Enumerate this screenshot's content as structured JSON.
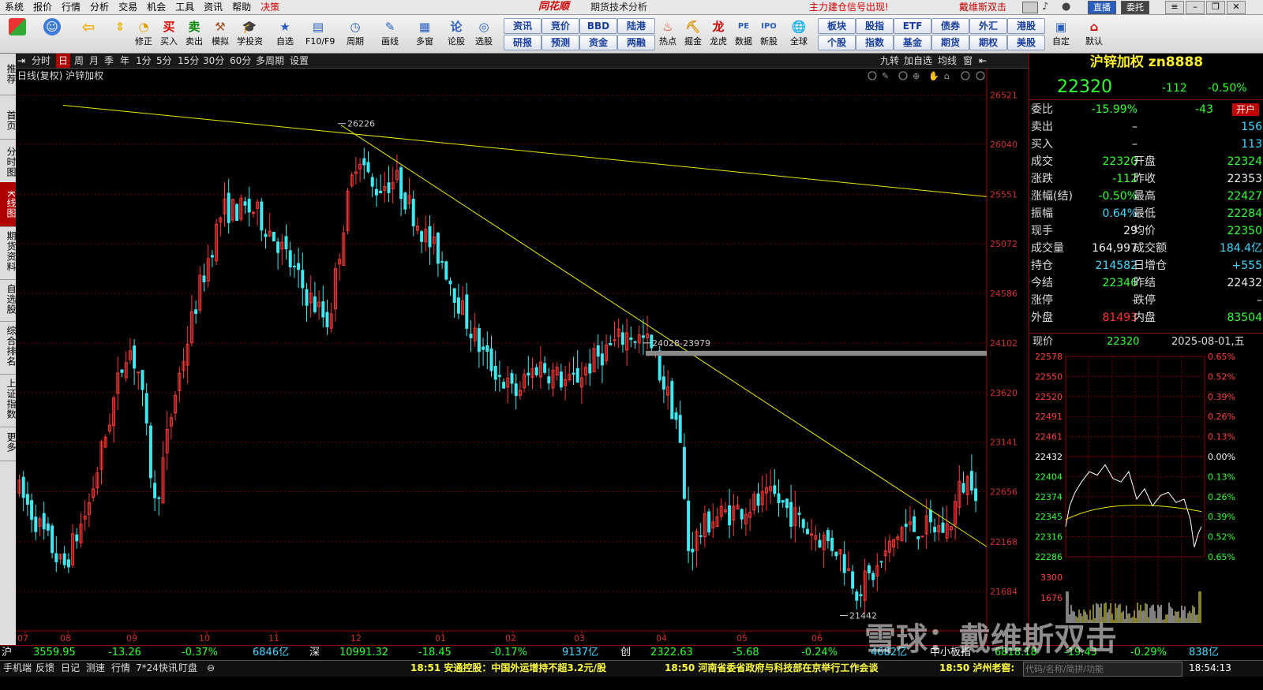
{
  "menu": [
    "系统",
    "报价",
    "行情",
    "分析",
    "交易",
    "机会",
    "工具",
    "资讯",
    "帮助",
    "决策"
  ],
  "brand": "同花顺",
  "brand_sub": "期货技术分析",
  "notice": "主力建仓信号出现!",
  "notice2": "戴维斯双击",
  "top_buttons": [
    "直播",
    "委托"
  ],
  "toolbar": [
    {
      "label": "",
      "icon": "app-grid-icon"
    },
    {
      "label": "",
      "icon": "robot-icon"
    },
    {
      "label": "",
      "icon": "back-arrow-icon"
    },
    {
      "label": "",
      "icon": "up-down-arrow-icon"
    },
    {
      "label": "修正",
      "icon": "correct-icon"
    },
    {
      "label": "买入",
      "icon": "buy-icon"
    },
    {
      "label": "卖出",
      "icon": "sell-icon"
    },
    {
      "label": "模拟",
      "icon": "hammer-icon"
    },
    {
      "label": "学投资",
      "icon": "grad-cap-icon"
    },
    {
      "label": "自选",
      "icon": "star-icon"
    },
    {
      "label": "F10/F9",
      "icon": "f10-icon"
    },
    {
      "label": "周期",
      "icon": "clock-icon"
    },
    {
      "label": "画线",
      "icon": "pen-icon"
    },
    {
      "label": "多窗",
      "icon": "multi-window-icon"
    },
    {
      "label": "论股",
      "icon": "discuss-icon"
    },
    {
      "label": "选股",
      "icon": "select-stock-icon"
    }
  ],
  "toolbar_boxes": [
    [
      "资讯",
      "研报"
    ],
    [
      "竞价",
      "预测"
    ],
    [
      "BBD",
      "资金"
    ],
    [
      "陆港",
      "两融"
    ]
  ],
  "toolbar2": [
    {
      "label": "热点",
      "icon": "hot-icon"
    },
    {
      "label": "掘金",
      "icon": "dig-gold-icon"
    },
    {
      "label": "龙虎",
      "icon": "dragon-tiger-icon"
    },
    {
      "label": "数据",
      "icon": "pe-data-icon"
    },
    {
      "label": "新股",
      "icon": "ipo-icon"
    },
    {
      "label": "全球",
      "icon": "globe-icon"
    }
  ],
  "toolbar_boxes2": [
    [
      "板块",
      "个股"
    ],
    [
      "股指",
      "指数"
    ],
    [
      "ETF",
      "基金"
    ],
    [
      "债券",
      "期货"
    ],
    [
      "外汇",
      "期权"
    ],
    [
      "港股",
      "美股"
    ]
  ],
  "toolbar3": [
    {
      "label": "自定",
      "icon": "custom-icon"
    },
    {
      "label": "默认",
      "icon": "home-icon"
    }
  ],
  "left_tabs": [
    {
      "label": "推荐",
      "active": false
    },
    {
      "label": "首页",
      "active": false
    },
    {
      "label": "分时图",
      "active": false
    },
    {
      "label": "K线图",
      "active": true
    },
    {
      "label": "期货资料",
      "active": false
    },
    {
      "label": "自选股",
      "active": false
    },
    {
      "label": "综合排名",
      "active": false
    },
    {
      "label": "上证指数",
      "active": false
    },
    {
      "label": "更多",
      "active": false
    }
  ],
  "period_bar": {
    "items": [
      "分时",
      "日",
      "周",
      "月",
      "季",
      "年",
      "1分",
      "5分",
      "15分",
      "30分",
      "60分",
      "多周期",
      "设置"
    ],
    "active": "日",
    "right_items": [
      "九转",
      "加自选",
      "均线",
      "窗"
    ]
  },
  "chart_header": "日线(复权) 沪锌加权",
  "chart_data": {
    "type": "candlestick",
    "title": "日线(复权) 沪锌加权",
    "ylim": [
      21400,
      26700
    ],
    "yticks": [
      26521,
      26040,
      25551,
      25072,
      24586,
      24102,
      23620,
      23141,
      22656,
      22168,
      21684
    ],
    "xticks": [
      "07",
      "08",
      "09",
      "10",
      "11",
      "12",
      "01",
      "02",
      "03",
      "04",
      "05",
      "06"
    ],
    "annotations": [
      "26226",
      "24028-23979",
      "21442"
    ],
    "key_points": [
      {
        "label": "high",
        "value": 26226
      },
      {
        "label": "gap",
        "range": [
          23979,
          24028
        ]
      },
      {
        "label": "low",
        "value": 21442
      },
      {
        "label": "last",
        "value": 22320
      }
    ]
  },
  "right_panel": {
    "title": "沪锌加权  zn8888",
    "price": "22320",
    "change": "-112",
    "change_pct": "-0.50%",
    "rows": [
      {
        "l": "委比",
        "v1": "-15.99%",
        "l2": "",
        "v2": "-43",
        "c1": "dn",
        "c2": "dn",
        "extra": "开户"
      },
      {
        "l": "卖出",
        "v1": "–",
        "l2": "",
        "v2": "156",
        "c1": "wh",
        "c2": "cy"
      },
      {
        "l": "买入",
        "v1": "–",
        "l2": "",
        "v2": "113",
        "c1": "wh",
        "c2": "cy"
      },
      {
        "l": "成交",
        "v1": "22320",
        "l2": "开盘",
        "v2": "22324",
        "c1": "dn",
        "c2": "dn"
      },
      {
        "l": "涨跌",
        "v1": "-112",
        "l2": "昨收",
        "v2": "22353",
        "c1": "dn",
        "c2": "wh"
      },
      {
        "l": "涨幅(结)",
        "v1": "-0.50%",
        "l2": "最高",
        "v2": "22427",
        "c1": "dn",
        "c2": "dn"
      },
      {
        "l": "振幅",
        "v1": "0.64%",
        "l2": "最低",
        "v2": "22284",
        "c1": "cy",
        "c2": "dn"
      },
      {
        "l": "现手",
        "v1": "29",
        "l2": "均价",
        "v2": "22350",
        "c1": "wh",
        "c2": "dn"
      },
      {
        "l": "成交量",
        "v1": "164,997",
        "l2": "成交额",
        "v2": "184.4亿",
        "c1": "wh",
        "c2": "cy"
      },
      {
        "l": "持仓",
        "v1": "214582",
        "l2": "日增仓",
        "v2": "+555",
        "c1": "cy",
        "c2": "cy"
      },
      {
        "l": "今结",
        "v1": "22346",
        "l2": "昨结",
        "v2": "22432",
        "c1": "dn",
        "c2": "wh"
      },
      {
        "l": "涨停",
        "v1": "–",
        "l2": "跌停",
        "v2": "–",
        "c1": "wh",
        "c2": "wh"
      },
      {
        "l": "外盘",
        "v1": "81493",
        "l2": "内盘",
        "v2": "83504",
        "c1": "up",
        "c2": "dn"
      }
    ],
    "mini_header": {
      "label": "现价",
      "price": "22320",
      "date": "2025-08-01,五"
    },
    "mini_left": [
      "22578",
      "22550",
      "22520",
      "22491",
      "22461",
      "22432",
      "22404",
      "22374",
      "22345",
      "22316",
      "22286"
    ],
    "mini_right": [
      "0.65%",
      "0.52%",
      "0.39%",
      "0.26%",
      "0.13%",
      "0.00%",
      "0.13%",
      "0.26%",
      "0.39%",
      "0.52%",
      "0.65%"
    ],
    "mini_vol": [
      "3300",
      "1676"
    ]
  },
  "index_bar": [
    {
      "t": "沪",
      "c": "wh"
    },
    {
      "t": "3559.95",
      "c": "dn"
    },
    {
      "t": "-13.26",
      "c": "dn"
    },
    {
      "t": "-0.37%",
      "c": "dn"
    },
    {
      "t": "6846亿",
      "c": "cy"
    },
    {
      "t": "深",
      "c": "wh"
    },
    {
      "t": "10991.32",
      "c": "dn"
    },
    {
      "t": "-18.45",
      "c": "dn"
    },
    {
      "t": "-0.17%",
      "c": "dn"
    },
    {
      "t": "9137亿",
      "c": "cy"
    },
    {
      "t": "创",
      "c": "wh"
    },
    {
      "t": "2322.63",
      "c": "dn"
    },
    {
      "t": "-5.68",
      "c": "dn"
    },
    {
      "t": "-0.24%",
      "c": "dn"
    },
    {
      "t": "4682亿",
      "c": "cy"
    },
    {
      "t": "中小板指",
      "c": "wh"
    },
    {
      "t": "6818.18",
      "c": "dn"
    },
    {
      "t": "-19.43",
      "c": "dn"
    },
    {
      "t": "-0.29%",
      "c": "dn"
    },
    {
      "t": "838亿",
      "c": "cy"
    }
  ],
  "status_bar": {
    "tabs": [
      "手机端",
      "反馈",
      "日记",
      "测速",
      "行情",
      "7*24快讯",
      "盯盘"
    ],
    "news": [
      "18:51 安通控股：中国外运增持不超3.2元/股",
      "18:50 河南省委省政府与科技部在京举行工作会谈",
      "18:50 泸州老窖:"
    ],
    "search_placeholder": "代码/名称/简拼/功能",
    "time": "18:54:13"
  },
  "watermark": "雪球：戴维斯双击"
}
